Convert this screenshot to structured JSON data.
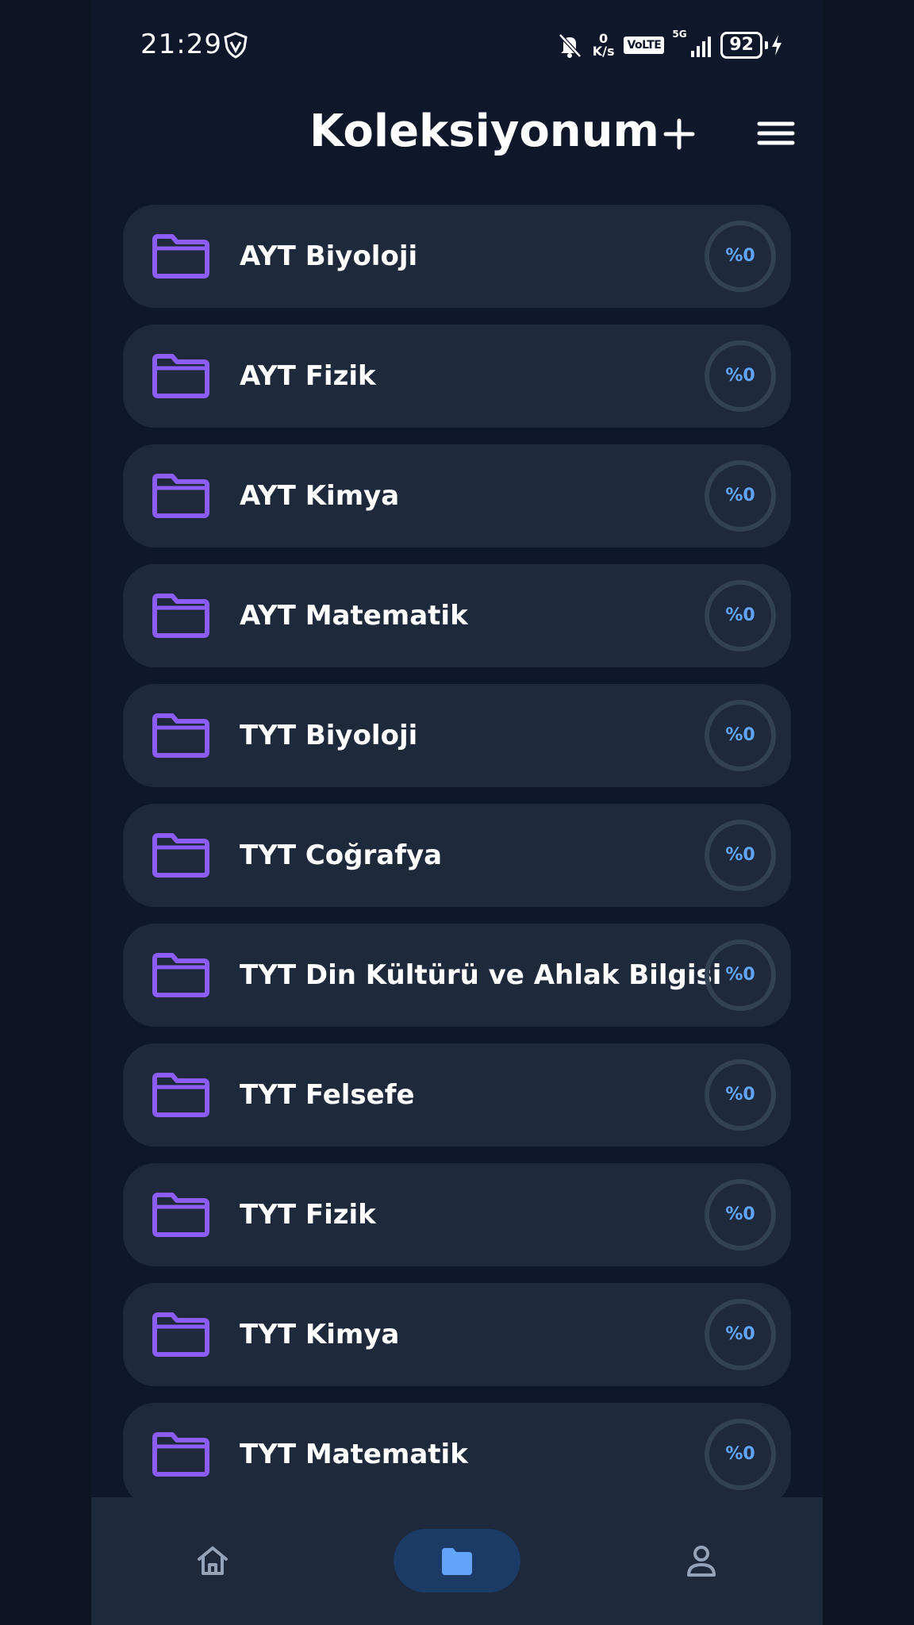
{
  "status_bar": {
    "time": "21:29",
    "net_speed_value": "0",
    "net_speed_unit": "K/s",
    "volte": "VoLTE",
    "network": "5G",
    "battery": "92"
  },
  "header": {
    "title": "Koleksiyonum"
  },
  "collections": [
    {
      "name": "AYT Biyoloji",
      "progress": "%0"
    },
    {
      "name": "AYT Fizik",
      "progress": "%0"
    },
    {
      "name": "AYT Kimya",
      "progress": "%0"
    },
    {
      "name": "AYT Matematik",
      "progress": "%0"
    },
    {
      "name": "TYT Biyoloji",
      "progress": "%0"
    },
    {
      "name": "TYT Coğrafya",
      "progress": "%0"
    },
    {
      "name": "TYT Din Kültürü ve Ahlak Bilgisi",
      "progress": "%0"
    },
    {
      "name": "TYT Felsefe",
      "progress": "%0"
    },
    {
      "name": "TYT Fizik",
      "progress": "%0"
    },
    {
      "name": "TYT Kimya",
      "progress": "%0"
    },
    {
      "name": "TYT Matematik",
      "progress": "%0"
    }
  ],
  "bottom_nav": {
    "items": [
      {
        "icon": "home-icon",
        "active": false
      },
      {
        "icon": "folder-icon",
        "active": true
      },
      {
        "icon": "user-icon",
        "active": false
      }
    ]
  },
  "colors": {
    "background": "#0f172a",
    "card": "#1e293b",
    "folder": "#8b5cf6",
    "progress_text": "#60a5fa",
    "ring": "#334155",
    "nav_active_bg": "#1c3a66",
    "nav_active_icon": "#60a5fa",
    "nav_inactive_icon": "#94a3b8"
  }
}
